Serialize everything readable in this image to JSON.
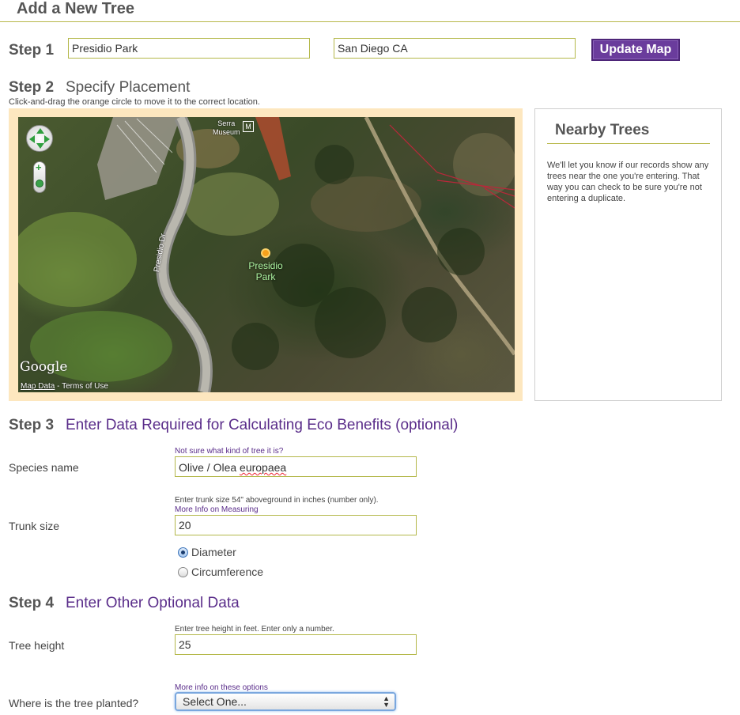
{
  "page": {
    "title": "Add a New Tree"
  },
  "step1": {
    "number": "Step 1",
    "location_value": "Presidio Park",
    "city_value": "San Diego CA",
    "update_button": "Update Map"
  },
  "step2": {
    "number": "Step 2",
    "title": "Specify Placement",
    "instructions": "Click-and-drag the orange circle to move it to the correct location.",
    "map": {
      "road_label": "Presidio Dr",
      "museum_label_line1": "Serra",
      "museum_label_line2": "Museum",
      "museum_icon": "M",
      "park_label_line1": "Presidio",
      "park_label_line2": "Park",
      "google_logo": "Google",
      "map_data_link": "Map Data",
      "terms_text": " - Terms of Use",
      "zoom_plus": "+"
    }
  },
  "nearby": {
    "title": "Nearby Trees",
    "text": "We'll let you know if our records show any trees near the one you're entering. That way you can check to be sure you're not entering a duplicate."
  },
  "step3": {
    "number": "Step 3",
    "title": "Enter Data Required for Calculating Eco Benefits (optional)",
    "species": {
      "label": "Species name",
      "hint": "Not sure what kind of tree it is?",
      "value_plain": "Olive / Olea ",
      "value_misspelled": "europaea"
    },
    "trunk": {
      "label": "Trunk size",
      "hint": "Enter trunk size 54\" aboveground in inches (number only).",
      "hint_link": "More Info on Measuring",
      "value": "20",
      "option_diameter": "Diameter",
      "option_circumference": "Circumference",
      "selected": "Diameter"
    }
  },
  "step4": {
    "number": "Step 4",
    "title": "Enter Other Optional Data",
    "height": {
      "label": "Tree height",
      "hint": "Enter tree height in feet. Enter only a number.",
      "value": "25"
    },
    "planted": {
      "label": "Where is the tree planted?",
      "hint_link": "More info on these options",
      "selected": "Select One..."
    }
  }
}
